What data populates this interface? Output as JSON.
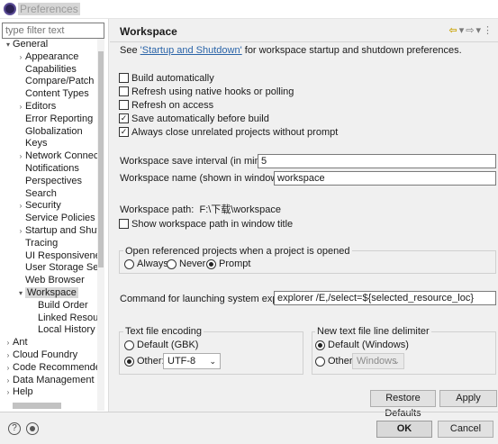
{
  "window": {
    "title": "Preferences"
  },
  "filter": {
    "placeholder": "type filter text"
  },
  "tree": [
    {
      "label": "General",
      "arrow": "▾",
      "indent": 0
    },
    {
      "label": "Appearance",
      "arrow": "›",
      "indent": 1
    },
    {
      "label": "Capabilities",
      "arrow": "",
      "indent": 1
    },
    {
      "label": "Compare/Patch",
      "arrow": "",
      "indent": 1
    },
    {
      "label": "Content Types",
      "arrow": "",
      "indent": 1
    },
    {
      "label": "Editors",
      "arrow": "›",
      "indent": 1
    },
    {
      "label": "Error Reporting",
      "arrow": "",
      "indent": 1
    },
    {
      "label": "Globalization",
      "arrow": "",
      "indent": 1
    },
    {
      "label": "Keys",
      "arrow": "",
      "indent": 1
    },
    {
      "label": "Network Connectio",
      "arrow": "›",
      "indent": 1
    },
    {
      "label": "Notifications",
      "arrow": "",
      "indent": 1
    },
    {
      "label": "Perspectives",
      "arrow": "",
      "indent": 1
    },
    {
      "label": "Search",
      "arrow": "",
      "indent": 1
    },
    {
      "label": "Security",
      "arrow": "›",
      "indent": 1
    },
    {
      "label": "Service Policies",
      "arrow": "",
      "indent": 1
    },
    {
      "label": "Startup and Shutd",
      "arrow": "›",
      "indent": 1
    },
    {
      "label": "Tracing",
      "arrow": "",
      "indent": 1
    },
    {
      "label": "UI Responsivenes",
      "arrow": "",
      "indent": 1
    },
    {
      "label": "User Storage Serv",
      "arrow": "",
      "indent": 1
    },
    {
      "label": "Web Browser",
      "arrow": "",
      "indent": 1
    },
    {
      "label": "Workspace",
      "arrow": "▾",
      "indent": 1,
      "selected": true
    },
    {
      "label": "Build Order",
      "arrow": "",
      "indent": 2
    },
    {
      "label": "Linked Resourc",
      "arrow": "",
      "indent": 2
    },
    {
      "label": "Local History",
      "arrow": "",
      "indent": 2
    },
    {
      "label": "Ant",
      "arrow": "›",
      "indent": 0
    },
    {
      "label": "Cloud Foundry",
      "arrow": "›",
      "indent": 0
    },
    {
      "label": "Code Recommenders",
      "arrow": "›",
      "indent": 0
    },
    {
      "label": "Data Management",
      "arrow": "›",
      "indent": 0
    },
    {
      "label": "Help",
      "arrow": "›",
      "indent": 0
    }
  ],
  "page": {
    "title": "Workspace",
    "see_prefix": "See ",
    "see_link": "'Startup and Shutdown'",
    "see_suffix": " for workspace startup and shutdown preferences."
  },
  "options": {
    "build_automatically": "Build automatically",
    "refresh_native": "Refresh using native hooks or polling",
    "refresh_access": "Refresh on access",
    "save_before_build": "Save automatically before build",
    "close_unrelated": "Always close unrelated projects without prompt"
  },
  "fields": {
    "save_interval_label": "Workspace save interval (in minutes):",
    "save_interval_value": "5",
    "workspace_name_label": "Workspace name (shown in window title):",
    "workspace_name_value": "workspace",
    "workspace_path_label": "Workspace path:",
    "workspace_path_value": "F:\\下载\\workspace",
    "show_path": "Show workspace path in window title"
  },
  "open_projects": {
    "title": "Open referenced projects when a project is opened",
    "always": "Always",
    "never": "Never",
    "prompt": "Prompt"
  },
  "explorer": {
    "label": "Command for launching system explorer:",
    "value": "explorer /E,/select=${selected_resource_loc}"
  },
  "encoding": {
    "title": "Text file encoding",
    "default": "Default (GBK)",
    "other": "Other:",
    "other_value": "UTF-8"
  },
  "delimiter": {
    "title": "New text file line delimiter",
    "default": "Default (Windows)",
    "other": "Other:",
    "other_value": "Windows"
  },
  "buttons": {
    "restore_defaults": "Restore Defaults",
    "apply": "Apply",
    "ok": "OK",
    "cancel": "Cancel",
    "help_glyph": "?"
  }
}
